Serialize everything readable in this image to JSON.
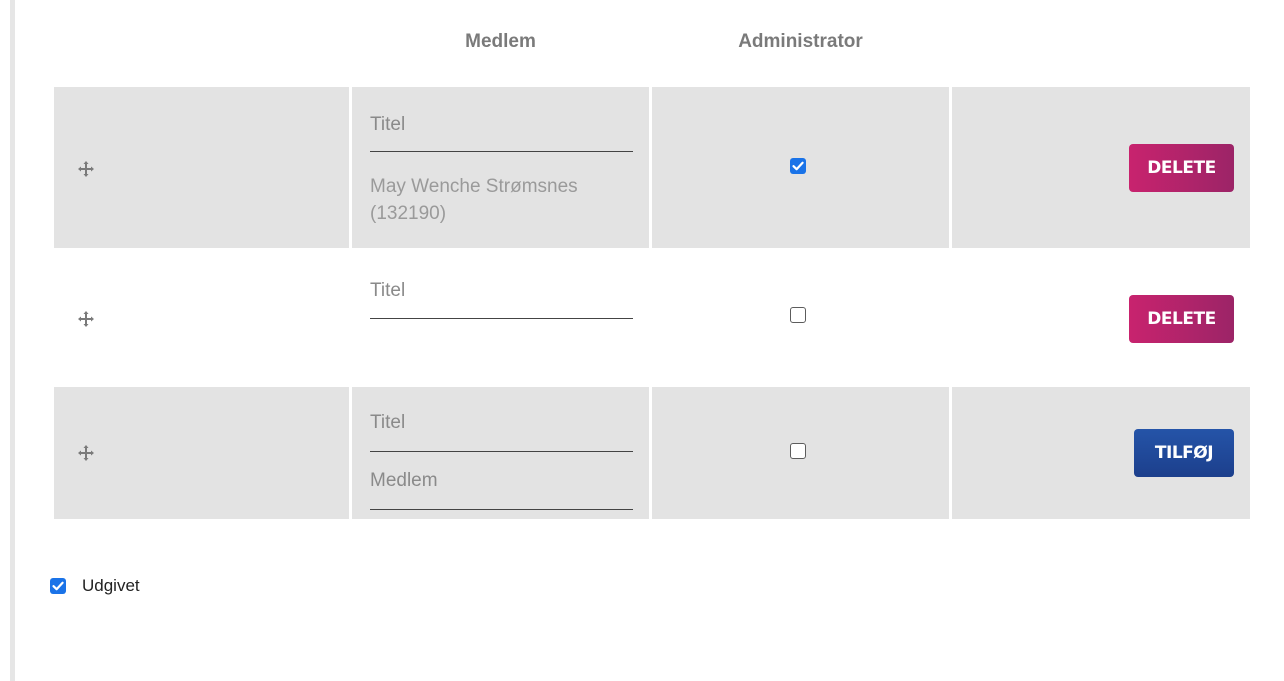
{
  "columns": {
    "member": "Medlem",
    "admin": "Administrator"
  },
  "rows": [
    {
      "title_placeholder": "Titel",
      "member_value": "May Wenche Strømsnes (132190)",
      "admin_checked": true,
      "action_label": "DELETE"
    },
    {
      "title_placeholder": "Titel",
      "member_value": "",
      "admin_checked": false,
      "action_label": "DELETE"
    },
    {
      "title_placeholder": "Titel",
      "member_placeholder": "Medlem",
      "admin_checked": false,
      "action_label": "TILFØJ"
    }
  ],
  "published": {
    "label": "Udgivet",
    "checked": true
  },
  "colors": {
    "delete": "#b4246b",
    "add": "#2150a0",
    "checkbox": "#1a73e8",
    "row_shade": "#e3e3e3"
  },
  "icons": {
    "drag": "move-icon",
    "check": "check-icon"
  }
}
